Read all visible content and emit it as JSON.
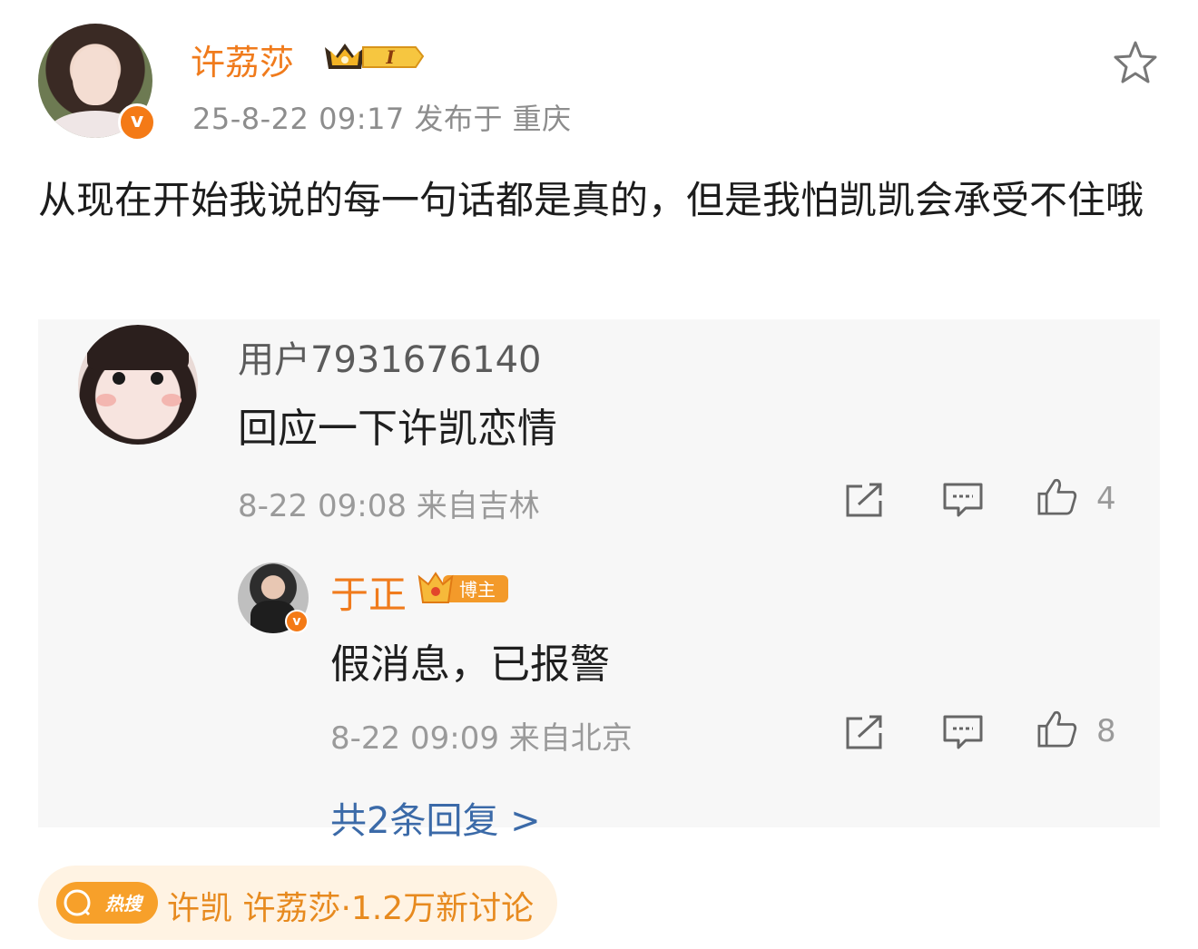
{
  "post": {
    "author": "许荔莎",
    "badge_level": "I",
    "meta": "25-8-22 09:17  发布于 重庆",
    "text": "从现在开始我说的每一句话都是真的，但是我怕凯凯会承受不住哦"
  },
  "comment": {
    "user": "用户7931676140",
    "text": "回应一下许凯恋情",
    "meta": "8-22 09:08  来自吉林",
    "likes": "4"
  },
  "reply": {
    "user": "于正",
    "badge": "博主",
    "text": "假消息，已报警",
    "meta": "8-22 09:09  来自北京",
    "likes": "8"
  },
  "more_replies": "共2条回复 >",
  "hot_search": {
    "tag": "热搜",
    "text": "许凯 许荔莎·1.2万新讨论"
  },
  "colors": {
    "accent_orange": "#f07b1c",
    "link_blue": "#3b6aa8",
    "meta_gray": "#9a9a9a"
  },
  "icons": [
    "star-icon",
    "verified-icon",
    "share-icon",
    "comment-icon",
    "like-icon",
    "search-icon"
  ]
}
